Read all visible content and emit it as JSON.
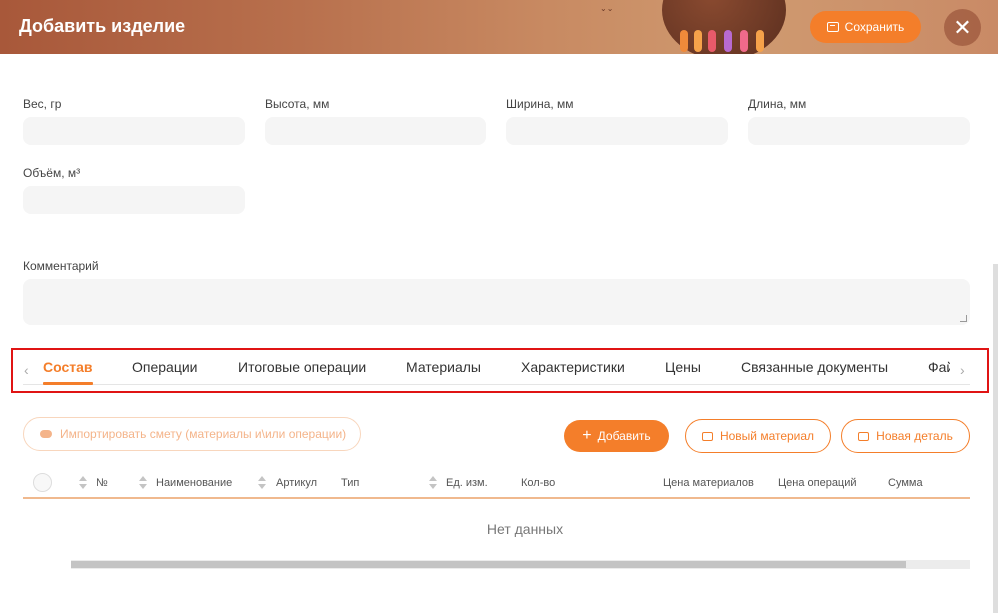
{
  "header": {
    "title": "Добавить изделие",
    "save_label": "Сохранить",
    "close_glyph": "✕"
  },
  "form": {
    "weight_label": "Вес, гр",
    "height_label": "Высота, мм",
    "width_label": "Ширина, мм",
    "length_label": "Длина, мм",
    "volume_label": "Объём, м³",
    "comment_label": "Комментарий",
    "weight_value": "",
    "height_value": "",
    "width_value": "",
    "length_value": "",
    "volume_value": "",
    "comment_value": ""
  },
  "tabs": {
    "prev_glyph": "‹",
    "next_glyph": "›",
    "items": [
      {
        "label": "Состав",
        "active": true
      },
      {
        "label": "Операции"
      },
      {
        "label": "Итоговые операции"
      },
      {
        "label": "Материалы"
      },
      {
        "label": "Характеристики"
      },
      {
        "label": "Цены"
      },
      {
        "label": "Связанные документы"
      },
      {
        "label": "Фай"
      }
    ]
  },
  "actions": {
    "import_label": "Импортировать смету (материалы и\\или операции)",
    "add_label": "Добавить",
    "add_glyph": "+",
    "new_material_label": "Новый материал",
    "new_detail_label": "Новая деталь"
  },
  "table": {
    "columns": [
      "№",
      "Наименование",
      "Артикул",
      "Тип",
      "Ед. изм.",
      "Кол-во",
      "Цена материалов",
      "Цена операций",
      "Сумма"
    ],
    "empty_text": "Нет данных"
  },
  "colors": {
    "accent": "#f47e2a",
    "highlight_border": "#e01414"
  }
}
